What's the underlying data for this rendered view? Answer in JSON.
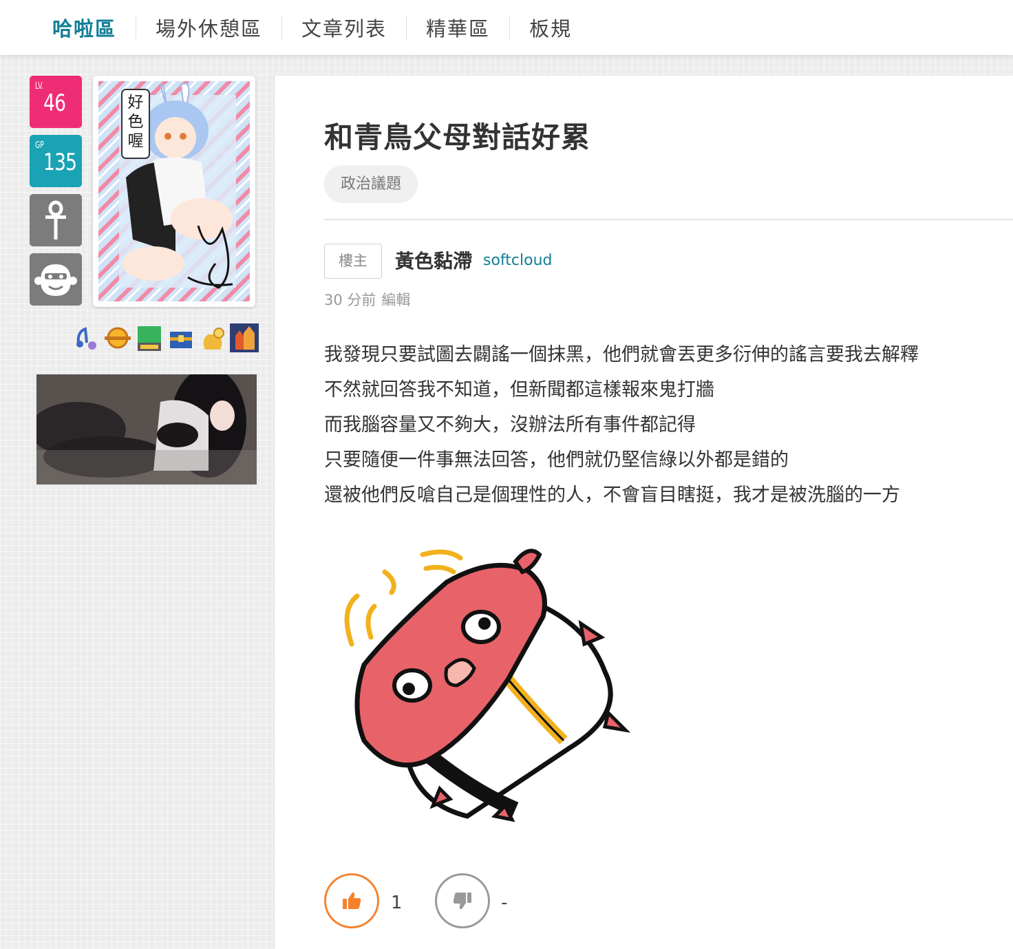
{
  "nav": {
    "items": [
      {
        "label": "哈啦區",
        "active": true
      },
      {
        "label": "場外休憩區",
        "active": false
      },
      {
        "label": "文章列表",
        "active": false
      },
      {
        "label": "精華區",
        "active": false
      },
      {
        "label": "板規",
        "active": false
      }
    ]
  },
  "user_panel": {
    "level_label": "LV.",
    "level": "46",
    "gp_label": "GP",
    "gp": "135",
    "avatar_caption": "好色喔",
    "colors": {
      "level_badge": "#ef2d75",
      "gp_badge": "#1aa3b4",
      "gray_badge": "#7c7c7c"
    },
    "medal_icons": [
      "music-note-medal-icon",
      "gold-coin-medal-icon",
      "flag-365-medal-icon",
      "treasure-chest-medal-icon",
      "money-bag-medal-icon",
      "castle-medal-icon"
    ]
  },
  "post": {
    "title": "和青鳥父母對話好累",
    "tag": "政治議題",
    "floor_label": "樓主",
    "author_name": "黃色黏滯",
    "author_id": "softcloud",
    "time": "30 分前",
    "edit_label": "編輯",
    "body_lines": [
      "我發現只要試圖去闢謠一個抹黑，他們就會丟更多衍伸的謠言要我去解釋",
      "不然就回答我不知道，但新聞都這樣報來鬼打牆",
      "而我腦容量又不夠大，沒辦法所有事件都記得",
      "只要隨便一件事無法回答，他們就仍堅信綠以外都是錯的",
      "還被他們反嗆自己是個理性的人，不會盲目瞎挺，我才是被洗腦的一方"
    ],
    "gp_count": "1",
    "bp_count": "-",
    "colors": {
      "accent": "#117e96",
      "gp": "#f5822b",
      "bp": "#999999"
    }
  }
}
